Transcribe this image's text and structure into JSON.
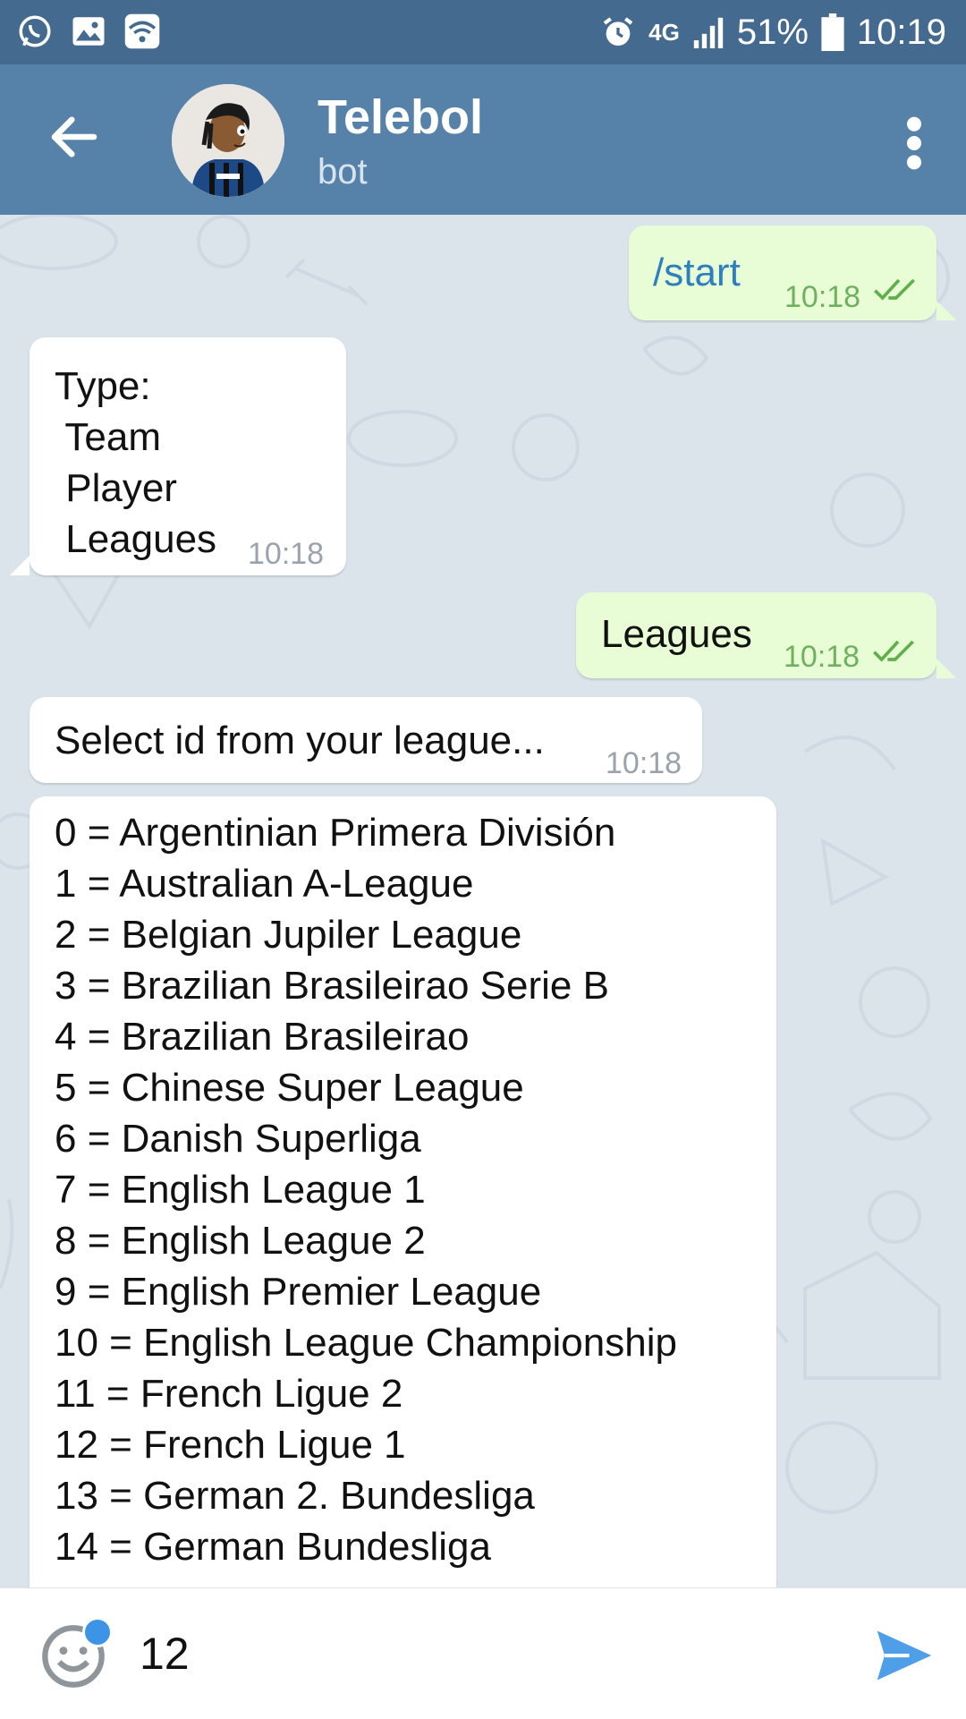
{
  "status_bar": {
    "network": "4G",
    "battery": "51%",
    "time": "10:19"
  },
  "header": {
    "title": "Telebol",
    "subtitle": "bot"
  },
  "messages": [
    {
      "direction": "outgoing",
      "text": "/start",
      "time": "10:18",
      "status": "read"
    },
    {
      "direction": "incoming",
      "text": "Type:\n Team\n Player\n Leagues",
      "time": "10:18"
    },
    {
      "direction": "outgoing",
      "text": "Leagues",
      "time": "10:18",
      "status": "read"
    },
    {
      "direction": "incoming",
      "text": "Select id from your league...",
      "time": "10:18"
    },
    {
      "direction": "incoming",
      "lines": [
        "0 = Argentinian Primera División",
        "1 = Australian A-League",
        "2 = Belgian Jupiler League",
        "3 = Brazilian Brasileirao Serie B",
        "4 = Brazilian Brasileirao",
        "5 = Chinese Super League",
        "6 = Danish Superliga",
        "7 = English League 1",
        "8 = English League 2",
        "9 = English Premier League",
        "10 = English League Championship",
        "11 = French Ligue 2",
        "12 = French Ligue 1",
        "13 = German 2. Bundesliga",
        "14 = German Bundesliga"
      ]
    }
  ],
  "input": {
    "value": "12"
  },
  "colors": {
    "status_bar": "#456a8f",
    "header": "#5682a9",
    "outgoing_bubble": "#e8fdd6",
    "incoming_bubble": "#ffffff",
    "read_check": "#5fb04a",
    "send_icon": "#4e9fe8"
  },
  "icons": {
    "status_left": [
      "whatsapp-icon",
      "gallery-icon",
      "wifi-icon"
    ],
    "status_right": [
      "alarm-icon",
      "signal-icon",
      "battery-icon"
    ],
    "header": [
      "back-arrow-icon",
      "more-vertical-icon"
    ],
    "input": [
      "emoji-icon",
      "send-icon"
    ]
  }
}
